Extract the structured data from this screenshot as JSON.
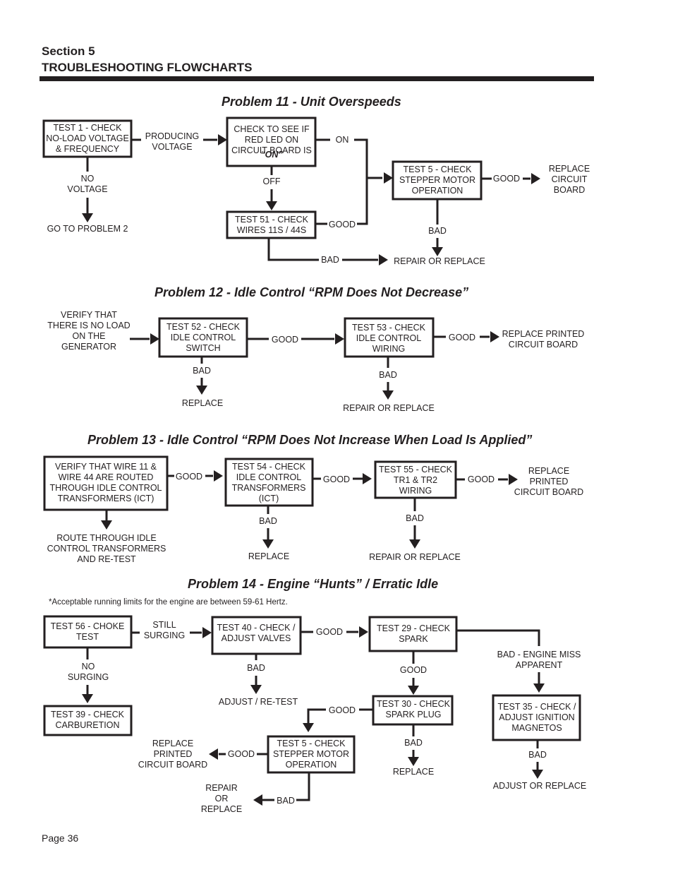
{
  "header": {
    "section": "Section 5",
    "title": "TROUBLESHOOTING FLOWCHARTS"
  },
  "footer": {
    "page": "Page 36"
  },
  "problems": [
    {
      "title": "Problem 11 -  Unit Overspeeds",
      "nodes": {
        "test1": [
          "TEST 1 - CHECK",
          "NO-LOAD VOLTAGE",
          "& FREQUENCY"
        ],
        "check_led": [
          "CHECK TO SEE IF",
          "RED LED ON",
          "CIRCUIT BOARD IS"
        ],
        "check_led_on": "“ON”",
        "test51": [
          "TEST 51 - CHECK",
          "WIRES 11S / 44S"
        ],
        "test5": [
          "TEST 5 - CHECK",
          "STEPPER MOTOR",
          "OPERATION"
        ]
      },
      "outcomes": {
        "go_problem2": "GO TO PROBLEM 2",
        "replace_board": [
          "REPLACE",
          "CIRCUIT",
          "BOARD"
        ],
        "repair_replace": "REPAIR OR REPLACE"
      },
      "edge_labels": {
        "producing_voltage": [
          "PRODUCING",
          "VOLTAGE"
        ],
        "no_voltage": [
          "NO",
          "VOLTAGE"
        ],
        "on": "ON",
        "off": "OFF",
        "good_51": "GOOD",
        "bad_51": "BAD",
        "good_5": "GOOD",
        "bad_5": "BAD"
      }
    },
    {
      "title": "Problem 12 -  Idle Control “RPM Does Not Decrease”",
      "nodes": {
        "verify_no_load": [
          "VERIFY THAT",
          "THERE IS NO LOAD",
          "ON THE",
          "GENERATOR"
        ],
        "test52": [
          "TEST 52 - CHECK",
          "IDLE CONTROL",
          "SWITCH"
        ],
        "test53": [
          "TEST 53 - CHECK",
          "IDLE CONTROL",
          "WIRING"
        ]
      },
      "outcomes": {
        "replace": "REPLACE",
        "repair_replace": "REPAIR OR REPLACE",
        "replace_pcb": [
          "REPLACE PRINTED",
          "CIRCUIT BOARD"
        ]
      },
      "edge_labels": {
        "good_52": "GOOD",
        "bad_52": "BAD",
        "good_53": "GOOD",
        "bad_53": "BAD"
      }
    },
    {
      "title": "Problem 13 -  Idle Control “RPM Does Not Increase When Load Is Applied”",
      "nodes": {
        "verify_wires": [
          "VERIFY THAT WIRE 11 &",
          "WIRE 44 ARE ROUTED",
          "THROUGH IDLE CONTROL",
          "TRANSFORMERS (ICT)"
        ],
        "test54": [
          "TEST 54 - CHECK",
          "IDLE CONTROL",
          "TRANSFORMERS",
          "(ICT)"
        ],
        "test55": [
          "TEST 55 - CHECK",
          "TR1 & TR2",
          "WIRING"
        ]
      },
      "outcomes": {
        "route_retest": [
          "ROUTE THROUGH IDLE",
          "CONTROL TRANSFORMERS",
          "AND RE-TEST"
        ],
        "replace": "REPLACE",
        "repair_replace": "REPAIR OR REPLACE",
        "replace_pcb": [
          "REPLACE",
          "PRINTED",
          "CIRCUIT BOARD"
        ]
      },
      "edge_labels": {
        "good_verify": "GOOD",
        "good_54": "GOOD",
        "bad_54": "BAD",
        "good_55": "GOOD",
        "bad_55": "BAD"
      }
    },
    {
      "title": "Problem 14 -  Engine “Hunts” / Erratic Idle",
      "note": "*Acceptable running limits for the engine are between 59-61 Hertz.",
      "nodes": {
        "test56": [
          "TEST 56 - CHOKE",
          "TEST"
        ],
        "test39": [
          "TEST 39 - CHECK",
          "CARBURETION"
        ],
        "test40": [
          "TEST 40 - CHECK /",
          "ADJUST VALVES"
        ],
        "test29": [
          "TEST 29 - CHECK",
          "SPARK"
        ],
        "test30": [
          "TEST 30 - CHECK",
          "SPARK PLUG"
        ],
        "test5": [
          "TEST 5 - CHECK",
          "STEPPER MOTOR",
          "OPERATION"
        ],
        "test35": [
          "TEST 35 - CHECK /",
          "ADJUST IGNITION",
          "MAGNETOS"
        ]
      },
      "outcomes": {
        "adjust_retest": "ADJUST / RE-TEST",
        "replace_30": "REPLACE",
        "replace_pcb": [
          "REPLACE",
          "PRINTED",
          "CIRCUIT BOARD"
        ],
        "repair_replace": [
          "REPAIR",
          "OR",
          "REPLACE"
        ],
        "adjust_replace": "ADJUST OR REPLACE"
      },
      "edge_labels": {
        "still_surging": [
          "STILL",
          "SURGING"
        ],
        "no_surging": [
          "NO",
          "SURGING"
        ],
        "good_40": "GOOD",
        "bad_40": "BAD",
        "good_29": "GOOD",
        "bad_engine_miss": [
          "BAD - ENGINE MISS",
          "APPARENT"
        ],
        "good_30": "GOOD",
        "bad_30": "BAD",
        "good_5": "GOOD",
        "bad_5": "BAD",
        "bad_35": "BAD"
      }
    }
  ]
}
